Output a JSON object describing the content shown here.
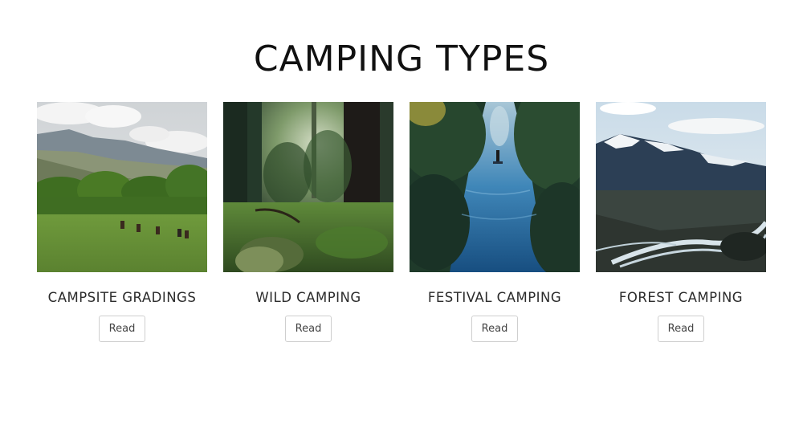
{
  "page": {
    "title": "CAMPING TYPES"
  },
  "cards": [
    {
      "title": "CAMPSITE GRADINGS",
      "button_label": "Read",
      "image": "meadow-riders-photo"
    },
    {
      "title": "WILD CAMPING",
      "button_label": "Read",
      "image": "forest-clearing-photo"
    },
    {
      "title": "FESTIVAL CAMPING",
      "button_label": "Read",
      "image": "river-paddleboard-photo"
    },
    {
      "title": "FOREST CAMPING",
      "button_label": "Read",
      "image": "snowy-mountain-valley-photo"
    }
  ],
  "colors": {
    "title_text": "#111111",
    "button_border": "#cfcfcf"
  }
}
